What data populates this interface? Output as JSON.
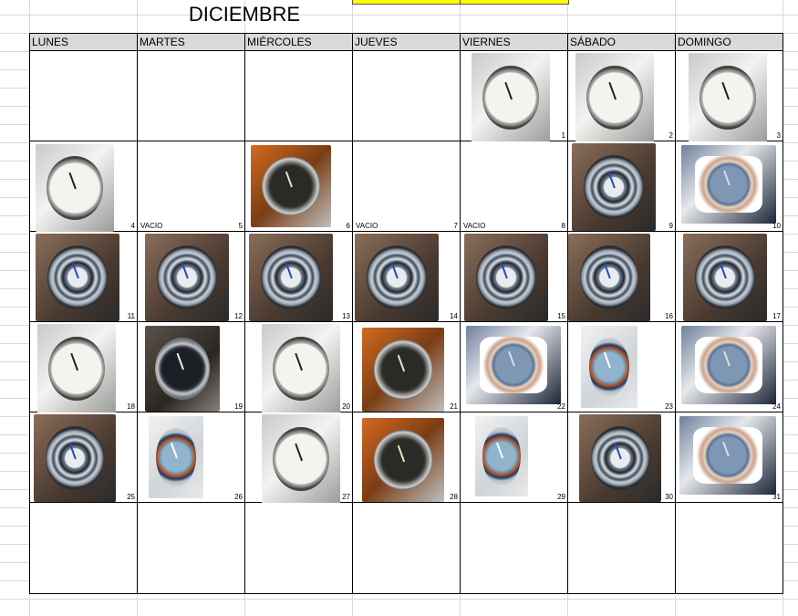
{
  "sheet": {
    "title": "DICIEMBRE"
  },
  "calendar": {
    "headers": [
      "LUNES",
      "MARTES",
      "MIÉRCOLES",
      "JUEVES",
      "VIERNES",
      "SÁBADO",
      "DOMINGO"
    ],
    "weeks": [
      [
        null,
        null,
        null,
        null,
        {
          "day": "1",
          "watch": "moonphase-watch"
        },
        {
          "day": "2",
          "watch": "moonphase-watch"
        },
        {
          "day": "3",
          "watch": "moonphase-watch"
        }
      ],
      [
        {
          "day": "4",
          "watch": "moonphase-watch"
        },
        {
          "day": "5",
          "note": "VACIO"
        },
        {
          "day": "6",
          "watch": "pilot-watch"
        },
        {
          "day": "7",
          "note": "VACIO"
        },
        {
          "day": "8",
          "note": "VACIO"
        },
        {
          "day": "9",
          "watch": "skeleton-chronograph-watch"
        },
        {
          "day": "10",
          "watch": "octagonal-blue-watch"
        }
      ],
      [
        {
          "day": "11",
          "watch": "skeleton-chronograph-watch"
        },
        {
          "day": "12",
          "watch": "skeleton-chronograph-watch"
        },
        {
          "day": "13",
          "watch": "skeleton-chronograph-watch"
        },
        {
          "day": "14",
          "watch": "skeleton-chronograph-watch"
        },
        {
          "day": "15",
          "watch": "skeleton-chronograph-watch"
        },
        {
          "day": "16",
          "watch": "skeleton-chronograph-watch"
        },
        {
          "day": "17",
          "watch": "skeleton-chronograph-watch"
        }
      ],
      [
        {
          "day": "18",
          "watch": "moonphase-watch"
        },
        {
          "day": "19",
          "watch": "black-chronograph-watch"
        },
        {
          "day": "20",
          "watch": "moonphase-watch"
        },
        {
          "day": "21",
          "watch": "pilot-watch"
        },
        {
          "day": "22",
          "watch": "octagonal-blue-watch"
        },
        {
          "day": "23",
          "watch": "diver-watch"
        },
        {
          "day": "24",
          "watch": "octagonal-blue-watch"
        }
      ],
      [
        {
          "day": "25",
          "watch": "skeleton-chronograph-watch"
        },
        {
          "day": "26",
          "watch": "diver-watch"
        },
        {
          "day": "27",
          "watch": "moonphase-watch"
        },
        {
          "day": "28",
          "watch": "pilot-watch"
        },
        {
          "day": "29",
          "watch": "diver-watch"
        },
        {
          "day": "30",
          "watch": "skeleton-chronograph-watch"
        },
        {
          "day": "31",
          "watch": "octagonal-blue-watch"
        }
      ],
      [
        null,
        null,
        null,
        null,
        null,
        null,
        null
      ]
    ]
  },
  "colors": {
    "header_bg": "#d9d9d9",
    "highlight": "#ffff00",
    "gridline": "#d9d9d9"
  }
}
